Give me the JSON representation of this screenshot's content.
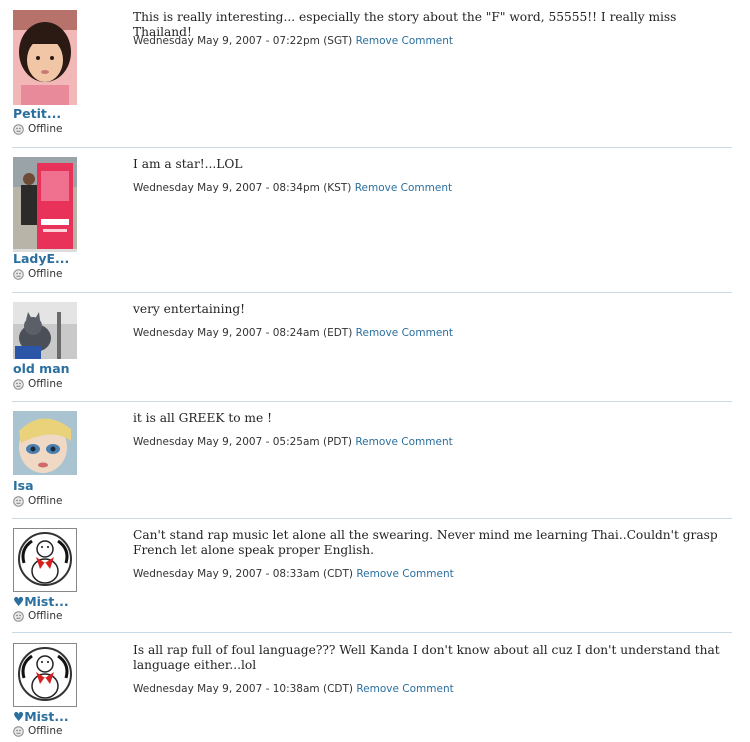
{
  "comments": [
    {
      "name": "Petit...",
      "status": "Offline",
      "text": "This is really interesting... especially the story about the \"F\" word, 55555!! I really miss Thailand!",
      "timestamp": "Wednesday May 9, 2007 - 07:22pm (SGT)",
      "remove_label": "Remove Comment",
      "avatar_icon": "child-photo-avatar"
    },
    {
      "name": "LadyE...",
      "status": "Offline",
      "text": "I am a star!...LOL",
      "timestamp": "Wednesday May 9, 2007 - 08:34pm (KST)",
      "remove_label": "Remove Comment",
      "avatar_icon": "picasso-poster-avatar"
    },
    {
      "name": "old man",
      "status": "Offline",
      "text": "very entertaining!",
      "timestamp": "Wednesday May 9, 2007 - 08:24am (EDT)",
      "remove_label": "Remove Comment",
      "avatar_icon": "cat-photo-avatar"
    },
    {
      "name": "Isa",
      "status": "Offline",
      "text": "it is all GREEK to me !",
      "timestamp": "Wednesday May 9, 2007 - 05:25am (PDT)",
      "remove_label": "Remove Comment",
      "avatar_icon": "doll-face-avatar"
    },
    {
      "name": "♥Mist...",
      "status": "Offline",
      "text": "Can't stand rap music let alone all the swearing. Never mind me learning Thai..Couldn't grasp French let alone speak proper English.",
      "timestamp": "Wednesday May 9, 2007 - 08:33am (CDT)",
      "remove_label": "Remove Comment",
      "avatar_icon": "snowman-avatar"
    },
    {
      "name": "♥Mist...",
      "status": "Offline",
      "text": "Is all rap full of foul language??? Well Kanda I don't know about all cuz I don't understand that language either...lol",
      "timestamp": "Wednesday May 9, 2007 - 10:38am (CDT)",
      "remove_label": "Remove Comment",
      "avatar_icon": "snowman-avatar"
    }
  ],
  "colors": {
    "link": "#2a6f9e",
    "separator": "#c9dbe6",
    "text": "#222222"
  }
}
